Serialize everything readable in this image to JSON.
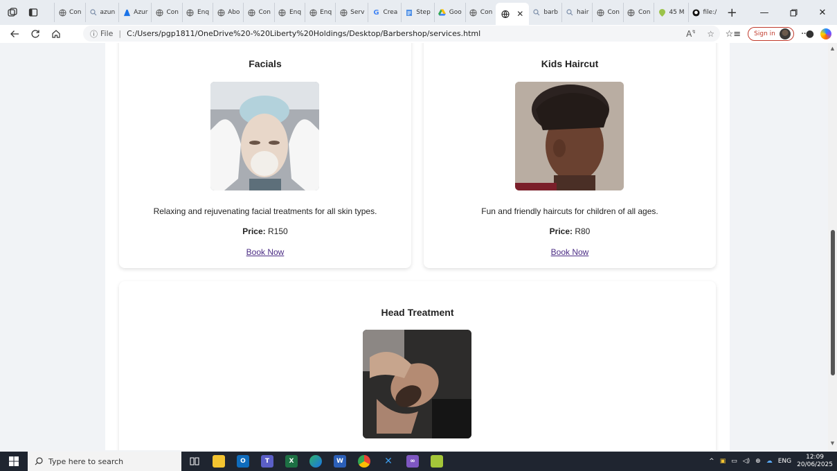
{
  "browser": {
    "tabs": [
      {
        "label": "Con",
        "icon": "globe-icon"
      },
      {
        "label": "azun",
        "icon": "search-icon"
      },
      {
        "label": "Azur",
        "icon": "azure-icon"
      },
      {
        "label": "Con",
        "icon": "globe-icon"
      },
      {
        "label": "Enq",
        "icon": "globe-icon"
      },
      {
        "label": "Abo",
        "icon": "globe-icon"
      },
      {
        "label": "Con",
        "icon": "globe-icon"
      },
      {
        "label": "Enq",
        "icon": "globe-icon"
      },
      {
        "label": "Enq",
        "icon": "globe-icon"
      },
      {
        "label": "Serv",
        "icon": "globe-icon"
      },
      {
        "label": "Crea",
        "icon": "google-icon"
      },
      {
        "label": "Step",
        "icon": "doc-icon"
      },
      {
        "label": "Goo",
        "icon": "drive-icon"
      },
      {
        "label": "Con",
        "icon": "globe-icon"
      }
    ],
    "active_tab_icon": "globe-icon",
    "tabs_after": [
      {
        "label": "barb",
        "icon": "search-icon"
      },
      {
        "label": "hair",
        "icon": "search-icon"
      },
      {
        "label": "Con",
        "icon": "globe-icon"
      },
      {
        "label": "Con",
        "icon": "globe-icon"
      },
      {
        "label": "45 M",
        "icon": "pin-icon"
      },
      {
        "label": "file:/",
        "icon": "github-icon"
      }
    ],
    "address": {
      "scheme": "File",
      "url": "C:/Users/pgp1811/OneDrive%20-%20Liberty%20Holdings/Desktop/Barbershop/services.html"
    },
    "sign_in_label": "Sign in",
    "colors": {
      "tabstrip": "#e8ecf1",
      "signin": "#c0392b"
    }
  },
  "page": {
    "services": [
      {
        "title": "Facials",
        "description": "Relaxing and rejuvenating facial treatments for all skin types.",
        "price_label": "Price:",
        "price": "R150",
        "link": "Book Now"
      },
      {
        "title": "Kids Haircut",
        "description": "Fun and friendly haircuts for children of all ages.",
        "price_label": "Price:",
        "price": "R80",
        "link": "Book Now"
      },
      {
        "title": "Head Treatment"
      }
    ],
    "link_color": "#4b2c84"
  },
  "taskbar": {
    "search_placeholder": "Type here to search",
    "apps": [
      "task-view-icon",
      "file-explorer-icon",
      "outlook-icon",
      "teams-icon",
      "excel-icon",
      "edge-icon",
      "word-icon",
      "chrome-icon",
      "vscode-icon",
      "visual-studio-icon",
      "notepad-icon"
    ],
    "language": "ENG",
    "time": "12:09",
    "date": "20/06/2025"
  }
}
